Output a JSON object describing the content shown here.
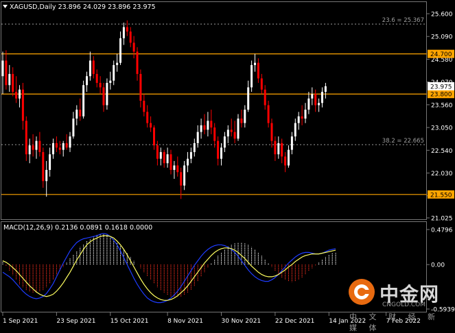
{
  "header": {
    "symbol_line": "XAGUSD,Daily  23.896 24.029 23.896 23.975"
  },
  "macd_header": "MACD(12,26,9) 0.2136 0.0891 0.1618 0.0000",
  "colors": {
    "background": "#000000",
    "bull_candle": "#ffffff",
    "bear_candle": "#ff0000",
    "level_line": "#ffa500",
    "fib_line": "#9e9e9e",
    "macd_pos_hist": "#ffffff",
    "macd_neg_hist": "#ff3020",
    "macd_line": "#1e3cff",
    "signal_line": "#ffff60",
    "axis_text": "#ffffff",
    "current_price_badge": "#ffffff"
  },
  "watermark": {
    "name": "中金网",
    "domain": "CNGOLD.COM",
    "slogan": "中 文 财 经 新 媒 体"
  },
  "chart_data": [
    {
      "type": "candlestick",
      "series_name": "XAGUSD,Daily",
      "ylim": [
        21.025,
        25.6
      ],
      "y_ticks": [
        25.6,
        25.09,
        24.58,
        24.07,
        23.56,
        23.05,
        22.54,
        22.03,
        21.52,
        21.025
      ],
      "y_tick_labels": [
        "25.600",
        "25.090",
        "24.580",
        "24.070",
        "23.560",
        "23.050",
        "22.540",
        "22.030",
        "21.520",
        "21.025"
      ],
      "x_tick_labels": [
        "1 Sep 2021",
        "23 Sep 2021",
        "15 Oct 2021",
        "8 Nov 2021",
        "30 Nov 2021",
        "22 Dec 2021",
        "14 Jan 2022",
        "7 Feb 2022"
      ],
      "x_tick_bar_index": [
        0,
        16,
        32,
        49,
        65,
        81,
        97,
        114
      ],
      "levels": [
        {
          "value": 24.7,
          "label": "24.700",
          "style": "horizontal",
          "badge": "level"
        },
        {
          "value": 23.8,
          "label": "23.800",
          "style": "horizontal",
          "badge": "level"
        },
        {
          "value": 21.55,
          "label": "21.550",
          "style": "horizontal",
          "badge": "level"
        }
      ],
      "fibo": [
        {
          "value": 25.367,
          "label": "23.6 = 25.367"
        },
        {
          "value": 22.665,
          "label": "38.2 = 22.665"
        }
      ],
      "current_price": {
        "value": 23.975,
        "label": "23.975"
      },
      "candles": [
        {
          "o": 24.2,
          "h": 24.75,
          "l": 23.8,
          "c": 24.55
        },
        {
          "o": 24.55,
          "h": 24.78,
          "l": 23.9,
          "c": 24.0
        },
        {
          "o": 24.0,
          "h": 24.45,
          "l": 23.85,
          "c": 24.25
        },
        {
          "o": 24.25,
          "h": 24.4,
          "l": 23.75,
          "c": 23.85
        },
        {
          "o": 23.85,
          "h": 24.2,
          "l": 23.6,
          "c": 23.7
        },
        {
          "o": 23.7,
          "h": 24.0,
          "l": 23.5,
          "c": 23.9
        },
        {
          "o": 23.9,
          "h": 24.05,
          "l": 23.0,
          "c": 23.2
        },
        {
          "o": 23.2,
          "h": 23.3,
          "l": 22.3,
          "c": 22.45
        },
        {
          "o": 22.45,
          "h": 22.8,
          "l": 22.25,
          "c": 22.65
        },
        {
          "o": 22.65,
          "h": 22.9,
          "l": 22.4,
          "c": 22.55
        },
        {
          "o": 22.55,
          "h": 22.85,
          "l": 22.35,
          "c": 22.75
        },
        {
          "o": 22.75,
          "h": 22.95,
          "l": 22.4,
          "c": 22.5
        },
        {
          "o": 22.5,
          "h": 22.6,
          "l": 21.7,
          "c": 21.85
        },
        {
          "o": 21.85,
          "h": 22.3,
          "l": 21.5,
          "c": 22.1
        },
        {
          "o": 22.1,
          "h": 22.6,
          "l": 21.95,
          "c": 22.45
        },
        {
          "o": 22.45,
          "h": 22.8,
          "l": 22.35,
          "c": 22.7
        },
        {
          "o": 22.7,
          "h": 22.85,
          "l": 22.5,
          "c": 22.6
        },
        {
          "o": 22.6,
          "h": 22.75,
          "l": 22.45,
          "c": 22.55
        },
        {
          "o": 22.55,
          "h": 22.75,
          "l": 22.4,
          "c": 22.7
        },
        {
          "o": 22.7,
          "h": 22.9,
          "l": 22.55,
          "c": 22.6
        },
        {
          "o": 22.6,
          "h": 22.95,
          "l": 22.5,
          "c": 22.85
        },
        {
          "o": 22.85,
          "h": 23.4,
          "l": 22.8,
          "c": 23.25
        },
        {
          "o": 23.25,
          "h": 23.55,
          "l": 23.1,
          "c": 23.45
        },
        {
          "o": 23.45,
          "h": 23.7,
          "l": 23.2,
          "c": 23.3
        },
        {
          "o": 23.3,
          "h": 24.1,
          "l": 23.25,
          "c": 24.0
        },
        {
          "o": 24.0,
          "h": 24.3,
          "l": 23.85,
          "c": 24.2
        },
        {
          "o": 24.2,
          "h": 24.75,
          "l": 24.1,
          "c": 24.55
        },
        {
          "o": 24.55,
          "h": 24.65,
          "l": 24.15,
          "c": 24.25
        },
        {
          "o": 24.25,
          "h": 24.35,
          "l": 23.95,
          "c": 24.05
        },
        {
          "o": 24.05,
          "h": 24.2,
          "l": 23.8,
          "c": 23.95
        },
        {
          "o": 23.95,
          "h": 24.05,
          "l": 23.4,
          "c": 23.55
        },
        {
          "o": 23.55,
          "h": 24.15,
          "l": 23.45,
          "c": 24.05
        },
        {
          "o": 24.05,
          "h": 24.3,
          "l": 23.9,
          "c": 24.1
        },
        {
          "o": 24.1,
          "h": 24.55,
          "l": 24.0,
          "c": 24.45
        },
        {
          "o": 24.45,
          "h": 24.7,
          "l": 24.3,
          "c": 24.5
        },
        {
          "o": 24.5,
          "h": 25.2,
          "l": 24.45,
          "c": 25.05
        },
        {
          "o": 25.05,
          "h": 25.4,
          "l": 24.9,
          "c": 25.3
        },
        {
          "o": 25.3,
          "h": 25.45,
          "l": 25.1,
          "c": 25.2
        },
        {
          "o": 25.2,
          "h": 25.3,
          "l": 24.85,
          "c": 24.95
        },
        {
          "o": 24.95,
          "h": 25.1,
          "l": 24.6,
          "c": 24.75
        },
        {
          "o": 24.75,
          "h": 24.85,
          "l": 24.1,
          "c": 24.25
        },
        {
          "o": 24.25,
          "h": 24.35,
          "l": 23.5,
          "c": 23.65
        },
        {
          "o": 23.65,
          "h": 23.8,
          "l": 23.3,
          "c": 23.4
        },
        {
          "o": 23.4,
          "h": 23.55,
          "l": 23.05,
          "c": 23.15
        },
        {
          "o": 23.15,
          "h": 23.3,
          "l": 22.95,
          "c": 23.05
        },
        {
          "o": 23.05,
          "h": 23.1,
          "l": 22.55,
          "c": 22.65
        },
        {
          "o": 22.65,
          "h": 22.75,
          "l": 22.2,
          "c": 22.35
        },
        {
          "o": 22.35,
          "h": 22.6,
          "l": 22.2,
          "c": 22.5
        },
        {
          "o": 22.5,
          "h": 22.55,
          "l": 22.15,
          "c": 22.25
        },
        {
          "o": 22.25,
          "h": 22.6,
          "l": 22.15,
          "c": 22.45
        },
        {
          "o": 22.45,
          "h": 22.55,
          "l": 22.0,
          "c": 22.1
        },
        {
          "o": 22.1,
          "h": 22.3,
          "l": 21.9,
          "c": 22.2
        },
        {
          "o": 22.2,
          "h": 22.4,
          "l": 21.95,
          "c": 22.05
        },
        {
          "o": 22.05,
          "h": 22.15,
          "l": 21.45,
          "c": 21.75
        },
        {
          "o": 21.75,
          "h": 22.3,
          "l": 21.65,
          "c": 22.2
        },
        {
          "o": 22.2,
          "h": 22.5,
          "l": 22.05,
          "c": 22.35
        },
        {
          "o": 22.35,
          "h": 22.6,
          "l": 22.25,
          "c": 22.5
        },
        {
          "o": 22.5,
          "h": 22.8,
          "l": 22.4,
          "c": 22.7
        },
        {
          "o": 22.7,
          "h": 23.1,
          "l": 22.6,
          "c": 22.95
        },
        {
          "o": 22.95,
          "h": 23.25,
          "l": 22.8,
          "c": 23.1
        },
        {
          "o": 23.1,
          "h": 23.35,
          "l": 22.9,
          "c": 23.0
        },
        {
          "o": 23.0,
          "h": 23.4,
          "l": 22.85,
          "c": 23.2
        },
        {
          "o": 23.2,
          "h": 23.45,
          "l": 22.9,
          "c": 23.05
        },
        {
          "o": 23.05,
          "h": 23.15,
          "l": 22.6,
          "c": 22.75
        },
        {
          "o": 22.75,
          "h": 22.85,
          "l": 22.2,
          "c": 22.35
        },
        {
          "o": 22.35,
          "h": 22.7,
          "l": 22.2,
          "c": 22.6
        },
        {
          "o": 22.6,
          "h": 22.95,
          "l": 22.5,
          "c": 22.85
        },
        {
          "o": 22.85,
          "h": 23.1,
          "l": 22.7,
          "c": 23.0
        },
        {
          "o": 23.0,
          "h": 23.25,
          "l": 22.85,
          "c": 22.95
        },
        {
          "o": 22.95,
          "h": 23.2,
          "l": 22.7,
          "c": 22.8
        },
        {
          "o": 22.8,
          "h": 23.35,
          "l": 22.75,
          "c": 23.25
        },
        {
          "o": 23.25,
          "h": 23.45,
          "l": 23.05,
          "c": 23.15
        },
        {
          "o": 23.15,
          "h": 23.55,
          "l": 23.05,
          "c": 23.45
        },
        {
          "o": 23.45,
          "h": 24.1,
          "l": 23.4,
          "c": 23.95
        },
        {
          "o": 23.95,
          "h": 24.55,
          "l": 23.85,
          "c": 24.45
        },
        {
          "o": 24.45,
          "h": 24.7,
          "l": 24.3,
          "c": 24.5
        },
        {
          "o": 24.5,
          "h": 24.6,
          "l": 24.05,
          "c": 24.15
        },
        {
          "o": 24.15,
          "h": 24.25,
          "l": 23.8,
          "c": 23.9
        },
        {
          "o": 23.9,
          "h": 24.0,
          "l": 23.45,
          "c": 23.55
        },
        {
          "o": 23.55,
          "h": 23.65,
          "l": 23.05,
          "c": 23.15
        },
        {
          "o": 23.15,
          "h": 23.25,
          "l": 22.6,
          "c": 22.75
        },
        {
          "o": 22.75,
          "h": 22.85,
          "l": 22.3,
          "c": 22.45
        },
        {
          "o": 22.45,
          "h": 22.85,
          "l": 22.35,
          "c": 22.7
        },
        {
          "o": 22.7,
          "h": 22.8,
          "l": 22.25,
          "c": 22.4
        },
        {
          "o": 22.4,
          "h": 22.5,
          "l": 22.05,
          "c": 22.2
        },
        {
          "o": 22.2,
          "h": 22.65,
          "l": 22.15,
          "c": 22.55
        },
        {
          "o": 22.55,
          "h": 22.95,
          "l": 22.45,
          "c": 22.85
        },
        {
          "o": 22.85,
          "h": 23.25,
          "l": 22.75,
          "c": 23.15
        },
        {
          "o": 23.15,
          "h": 23.4,
          "l": 23.0,
          "c": 23.3
        },
        {
          "o": 23.3,
          "h": 23.55,
          "l": 23.1,
          "c": 23.25
        },
        {
          "o": 23.25,
          "h": 23.6,
          "l": 23.15,
          "c": 23.45
        },
        {
          "o": 23.45,
          "h": 23.85,
          "l": 23.35,
          "c": 23.7
        },
        {
          "o": 23.7,
          "h": 23.95,
          "l": 23.55,
          "c": 23.8
        },
        {
          "o": 23.8,
          "h": 23.9,
          "l": 23.4,
          "c": 23.55
        },
        {
          "o": 23.55,
          "h": 23.7,
          "l": 23.4,
          "c": 23.6
        },
        {
          "o": 23.6,
          "h": 23.95,
          "l": 23.5,
          "c": 23.85
        },
        {
          "o": 23.85,
          "h": 24.05,
          "l": 23.7,
          "c": 23.975
        }
      ]
    },
    {
      "type": "macd",
      "series_name": "MACD(12,26,9)",
      "parameters": [
        12,
        26,
        9
      ],
      "values_shown": [
        0.2136,
        0.0891,
        0.1618,
        0.0
      ],
      "ylim": [
        -0.5939,
        0.4796
      ],
      "y_tick_labels": [
        "0.4796",
        "0.00",
        "-0.5939"
      ],
      "histogram": [
        0.05,
        -0.02,
        -0.08,
        -0.14,
        -0.2,
        -0.26,
        -0.3,
        -0.34,
        -0.36,
        -0.37,
        -0.37,
        -0.36,
        -0.34,
        -0.3,
        -0.25,
        -0.2,
        -0.14,
        -0.08,
        -0.03,
        0.03,
        0.08,
        0.13,
        0.18,
        0.23,
        0.27,
        0.31,
        0.34,
        0.37,
        0.39,
        0.4,
        0.4,
        0.39,
        0.36,
        0.33,
        0.29,
        0.25,
        0.2,
        0.15,
        0.1,
        0.05,
        0.0,
        -0.05,
        -0.1,
        -0.15,
        -0.2,
        -0.25,
        -0.3,
        -0.34,
        -0.37,
        -0.4,
        -0.42,
        -0.43,
        -0.43,
        -0.42,
        -0.4,
        -0.37,
        -0.33,
        -0.28,
        -0.22,
        -0.16,
        -0.1,
        -0.04,
        0.02,
        0.07,
        0.12,
        0.16,
        0.2,
        0.24,
        0.26,
        0.28,
        0.29,
        0.29,
        0.28,
        0.26,
        0.23,
        0.2,
        0.16,
        0.12,
        0.07,
        0.02,
        -0.03,
        -0.08,
        -0.13,
        -0.17,
        -0.2,
        -0.22,
        -0.23,
        -0.22,
        -0.2,
        -0.17,
        -0.13,
        -0.09,
        -0.05,
        -0.01,
        0.03,
        0.07,
        0.1,
        0.13,
        0.15,
        0.16
      ],
      "macd_line": [
        -0.1,
        -0.13,
        -0.16,
        -0.2,
        -0.25,
        -0.3,
        -0.35,
        -0.39,
        -0.42,
        -0.44,
        -0.45,
        -0.44,
        -0.42,
        -0.38,
        -0.32,
        -0.25,
        -0.16,
        -0.07,
        0.02,
        0.1,
        0.18,
        0.24,
        0.29,
        0.32,
        0.34,
        0.35,
        0.36,
        0.37,
        0.38,
        0.4,
        0.41,
        0.4,
        0.37,
        0.32,
        0.26,
        0.18,
        0.09,
        0.0,
        -0.09,
        -0.18,
        -0.26,
        -0.33,
        -0.39,
        -0.44,
        -0.47,
        -0.49,
        -0.5,
        -0.5,
        -0.49,
        -0.47,
        -0.44,
        -0.4,
        -0.35,
        -0.29,
        -0.22,
        -0.15,
        -0.08,
        -0.01,
        0.05,
        0.11,
        0.16,
        0.2,
        0.23,
        0.25,
        0.26,
        0.26,
        0.25,
        0.23,
        0.2,
        0.16,
        0.11,
        0.05,
        -0.01,
        -0.07,
        -0.12,
        -0.16,
        -0.19,
        -0.21,
        -0.22,
        -0.22,
        -0.2,
        -0.17,
        -0.13,
        -0.08,
        -0.03,
        0.02,
        0.06,
        0.1,
        0.13,
        0.15,
        0.16,
        0.16,
        0.15,
        0.14,
        0.14,
        0.15,
        0.17,
        0.19,
        0.2,
        0.21
      ],
      "signal_line": [
        0.05,
        0.03,
        0.0,
        -0.04,
        -0.08,
        -0.13,
        -0.18,
        -0.23,
        -0.28,
        -0.32,
        -0.36,
        -0.39,
        -0.41,
        -0.42,
        -0.41,
        -0.39,
        -0.35,
        -0.3,
        -0.24,
        -0.17,
        -0.1,
        -0.02,
        0.06,
        0.13,
        0.2,
        0.26,
        0.3,
        0.33,
        0.35,
        0.37,
        0.38,
        0.38,
        0.37,
        0.35,
        0.31,
        0.26,
        0.2,
        0.13,
        0.05,
        -0.03,
        -0.11,
        -0.19,
        -0.26,
        -0.32,
        -0.37,
        -0.41,
        -0.44,
        -0.46,
        -0.47,
        -0.47,
        -0.46,
        -0.44,
        -0.41,
        -0.37,
        -0.33,
        -0.28,
        -0.22,
        -0.16,
        -0.1,
        -0.04,
        0.02,
        0.07,
        0.12,
        0.16,
        0.19,
        0.21,
        0.22,
        0.22,
        0.21,
        0.19,
        0.16,
        0.12,
        0.08,
        0.03,
        -0.02,
        -0.06,
        -0.1,
        -0.13,
        -0.15,
        -0.16,
        -0.16,
        -0.15,
        -0.13,
        -0.1,
        -0.07,
        -0.03,
        0.0,
        0.04,
        0.07,
        0.1,
        0.12,
        0.13,
        0.14,
        0.14,
        0.14,
        0.15,
        0.16,
        0.17,
        0.18,
        0.19
      ]
    }
  ]
}
